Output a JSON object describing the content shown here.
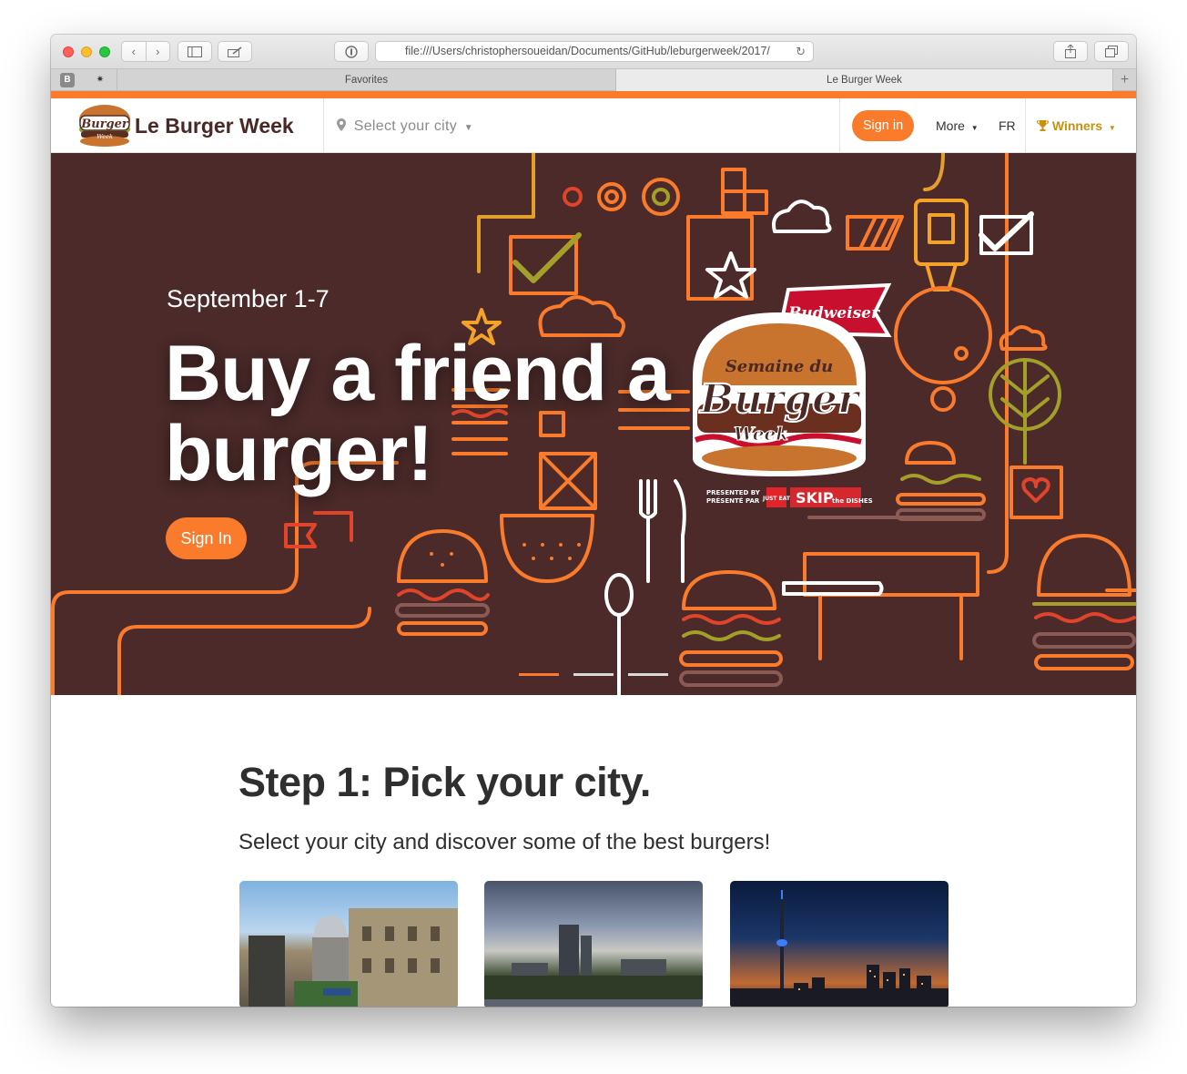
{
  "browser": {
    "url": "file:///Users/christophersoueidan/Documents/GitHub/leburgerweek/2017/",
    "tabs": [
      {
        "label": "Favorites"
      },
      {
        "label": "Le Burger Week"
      }
    ],
    "pinned_icons": [
      "bootstrap-icon",
      "extension-icon"
    ]
  },
  "header": {
    "brand_name": "Le Burger Week",
    "city_select": "Select your city",
    "signin_label": "Sign in",
    "more_label": "More",
    "lang_label": "FR",
    "winners_label": "Winners"
  },
  "hero": {
    "date": "September 1-7",
    "title": "Buy a friend a burger!",
    "button_label": "Sign In",
    "slides": {
      "count": 3,
      "active": 1
    },
    "badge": {
      "line1": "Semaine du",
      "line2": "Burger",
      "line3": "Week",
      "sponsor": "Budweiser",
      "presented_by": "PRESENTED BY",
      "presente_par": "PRÉSENTÉ PAR",
      "partner1": "JUST EAT",
      "partner2": "SKIP",
      "partner2_small": "the DISHES"
    }
  },
  "content": {
    "step_title": "Step 1: Pick your city.",
    "step_subtitle": "Select your city and discover some of the best burgers!",
    "cities": [
      {
        "name": "montreal-photo"
      },
      {
        "name": "edmonton-photo"
      },
      {
        "name": "toronto-photo"
      }
    ]
  },
  "colors": {
    "accent": "#f97b2b",
    "hero_bg": "#4b2a29",
    "brand_text": "#4a2825",
    "winners": "#c8900e"
  }
}
